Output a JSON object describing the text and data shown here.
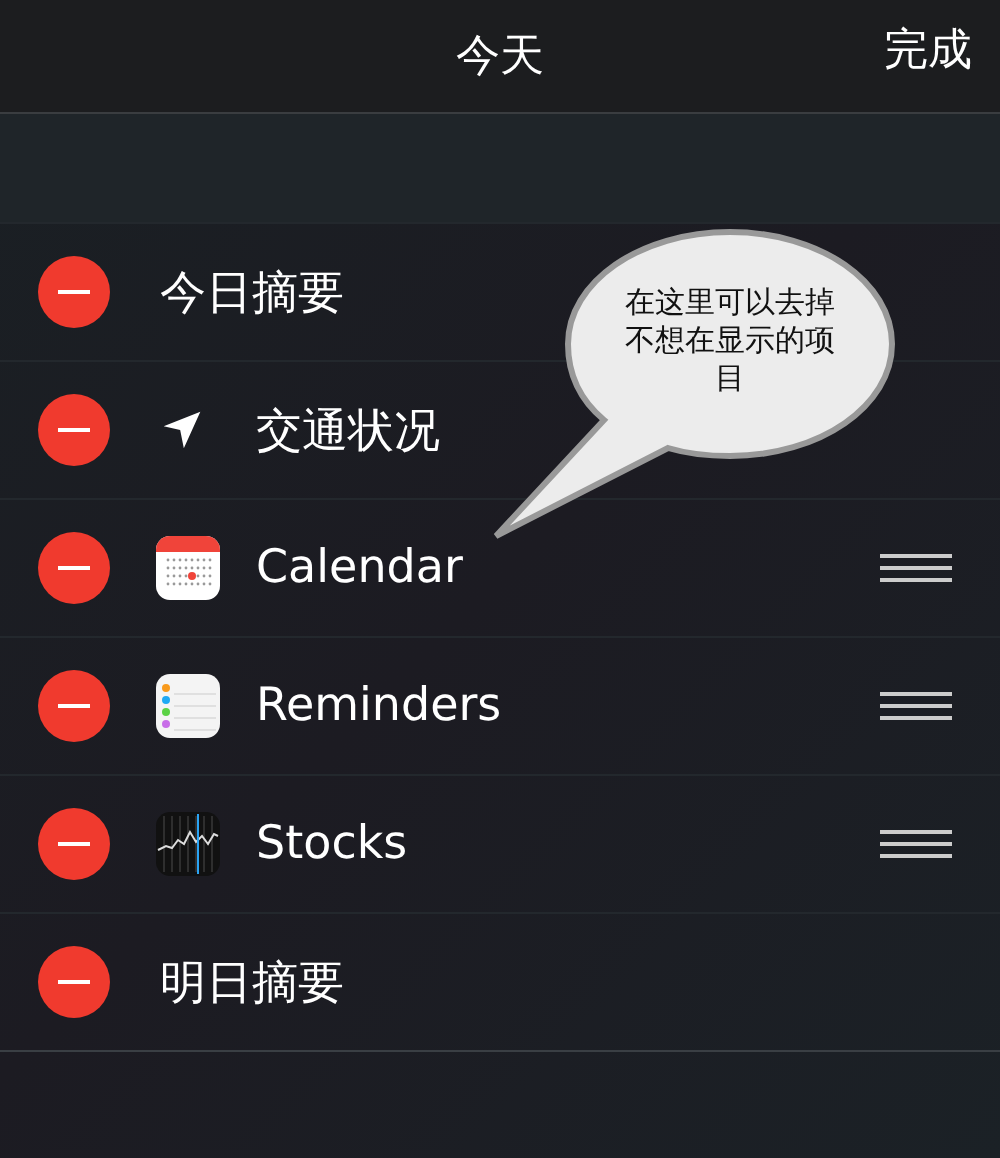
{
  "nav_bar": {
    "title": "今天",
    "done_button": "完成"
  },
  "widgets": [
    {
      "kind": "text",
      "label": "今日摘要",
      "reorderable": false
    },
    {
      "kind": "traffic",
      "label": "交通状况",
      "reorderable": false
    },
    {
      "kind": "calendar",
      "label": "Calendar",
      "reorderable": true
    },
    {
      "kind": "reminders",
      "label": "Reminders",
      "reorderable": true
    },
    {
      "kind": "stocks",
      "label": "Stocks",
      "reorderable": true
    },
    {
      "kind": "text",
      "label": "明日摘要",
      "reorderable": false
    }
  ],
  "callout": {
    "text": "在这里可以去掉不想在显示的项目"
  }
}
